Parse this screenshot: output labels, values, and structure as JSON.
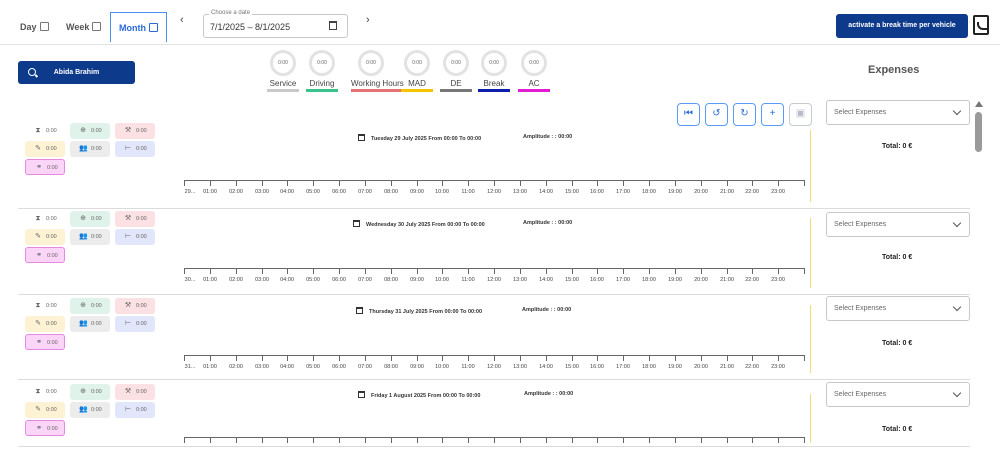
{
  "tabs": [
    {
      "label": "Day",
      "active": false
    },
    {
      "label": "Week",
      "active": false
    },
    {
      "label": "Month",
      "active": true
    }
  ],
  "date_picker": {
    "label": "Choose a date",
    "value": "7/1/2025 – 8/1/2025"
  },
  "break_button": "activate a break time per vehicle",
  "driver_button": "Abida Brahim",
  "legend": [
    {
      "name": "Service",
      "value": "0:00",
      "color": "#c9c9c9"
    },
    {
      "name": "Driving",
      "value": "0:00",
      "color": "#39c28a"
    },
    {
      "name": "Working Hours",
      "value": "0:00",
      "color": "#e57373"
    },
    {
      "name": "MAD",
      "value": "0:00",
      "color": "#f5c400"
    },
    {
      "name": "DE",
      "value": "0:00",
      "color": "#777777"
    },
    {
      "name": "Break",
      "value": "0:00",
      "color": "#0b1fa8"
    },
    {
      "name": "AC",
      "value": "0:00",
      "color": "#e31bd3"
    }
  ],
  "expenses_title": "Expenses",
  "toolbar_icons": [
    "skip-back-icon",
    "undo-icon",
    "redo-icon",
    "plus-icon",
    "save-icon"
  ],
  "days": [
    {
      "chips": {
        "service": "0:00",
        "driving": "0:00",
        "working": "0:00",
        "mad": "0:00",
        "de": "0:00",
        "break": "0:00",
        "ac": "0:00"
      },
      "title": "Tuesday 29 July 2025 From 00:00 To 00:00",
      "amplitude": "Amplitude : : 00:00",
      "first_tick": "29...",
      "select_placeholder": "Select Expenses",
      "total": "Total: 0 €"
    },
    {
      "chips": {
        "service": "0:00",
        "driving": "0:00",
        "working": "0:00",
        "mad": "0:00",
        "de": "0:00",
        "break": "0:00",
        "ac": "0:00"
      },
      "title": "Wednesday 30 July 2025 From 00:00 To 00:00",
      "amplitude": "Amplitude : : 00:00",
      "first_tick": "30...",
      "select_placeholder": "Select Expenses",
      "total": "Total: 0 €"
    },
    {
      "chips": {
        "service": "0:00",
        "driving": "0:00",
        "working": "0:00",
        "mad": "0:00",
        "de": "0:00",
        "break": "0:00",
        "ac": "0:00"
      },
      "title": "Thursday 31 July 2025 From 00:00 To 00:00",
      "amplitude": "Amplitude : : 00:00",
      "first_tick": "31...",
      "select_placeholder": "Select Expenses",
      "total": "Total: 0 €"
    },
    {
      "chips": {
        "service": "0:00",
        "driving": "0:00",
        "working": "0:00",
        "mad": "0:00",
        "de": "0:00",
        "break": "0:00",
        "ac": "0:00"
      },
      "title": "Friday 1 August 2025 From 00:00 To 00:00",
      "amplitude": "Amplitude : : 00:00",
      "first_tick": "",
      "select_placeholder": "Select Expenses",
      "total": "Total: 0 €"
    }
  ],
  "hours": [
    "01:00",
    "02:00",
    "03:00",
    "04:00",
    "05:00",
    "06:00",
    "07:00",
    "08:00",
    "09:00",
    "10:00",
    "11:00",
    "12:00",
    "13:00",
    "14:00",
    "15:00",
    "16:00",
    "17:00",
    "18:00",
    "19:00",
    "20:00",
    "21:00",
    "22:00",
    "23:00"
  ]
}
